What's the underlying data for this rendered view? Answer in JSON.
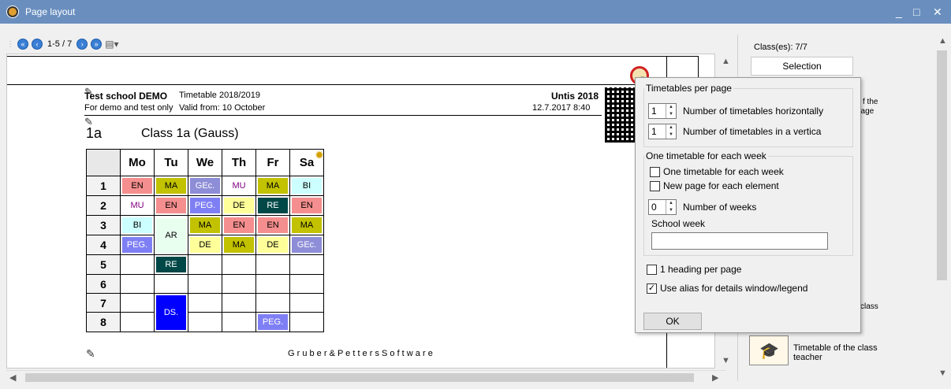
{
  "window": {
    "title": "Page layout",
    "minimize": "_",
    "maximize": "□",
    "close": "✕"
  },
  "toolbar": {
    "page_info": "1-5 / 7"
  },
  "doc": {
    "school": "Test school  DEMO",
    "school_sub": "For demo and test only",
    "tt_title": "Timetable 2018/2019",
    "valid_from": "Valid from: 10 October",
    "product": "Untis 2018",
    "date": "12.7.2017 8:40",
    "class_code": "1a",
    "class_name": "Class 1a (Gauss)",
    "footer": "G r u b e r  &  P e t t e r s  S o f t w a r e",
    "days": [
      "Mo",
      "Tu",
      "We",
      "Th",
      "Fr",
      "Sa"
    ],
    "periods": [
      "1",
      "2",
      "3",
      "4",
      "5",
      "6",
      "7",
      "8"
    ],
    "cells": {
      "r1": [
        "EN",
        "MA",
        "GEc.",
        "MU",
        "MA",
        "BI"
      ],
      "r2": [
        "MU",
        "EN",
        "PEG.",
        "DE",
        "RE",
        "EN"
      ],
      "r3": [
        "BI",
        "AR",
        "MA",
        "EN",
        "EN",
        "MA"
      ],
      "r4": [
        "PEG.",
        "DE",
        "MA",
        "DE",
        "GEc."
      ],
      "r5": [
        "RE"
      ],
      "r7": [
        "DS."
      ],
      "r8": [
        "PEG."
      ]
    },
    "colors": {
      "EN": "#f58e8e",
      "MA": "#c2c200",
      "GEc": "#8d8dd8",
      "MU": "#ffffff",
      "BI": "#ccffff",
      "PEG": "#7f7ff5",
      "DE": "#ffff99",
      "RE": "#004848",
      "AR": "#ffffff",
      "DS": "#0000ff"
    }
  },
  "right_panel": {
    "classes": "Class(es): 7/7",
    "selection_btn": "Selection",
    "partial1": "f the",
    "partial2": "page",
    "partial3": "class",
    "teacher_item": "Timetable of the class teacher"
  },
  "popup": {
    "group1": "Timetables per page",
    "horiz_val": "1",
    "horiz_label": "Number of timetables horizontally",
    "vert_val": "1",
    "vert_label": "Number of timetables in a vertica",
    "group2": "One timetable for each week",
    "cb_one": "One timetable for each week",
    "cb_newpage": "New page for each element",
    "weeks_val": "0",
    "weeks_label": "Number of weeks",
    "school_week": "School week",
    "cb_heading": "1 heading per page",
    "cb_alias": "Use alias for details window/legend",
    "ok": "OK"
  }
}
